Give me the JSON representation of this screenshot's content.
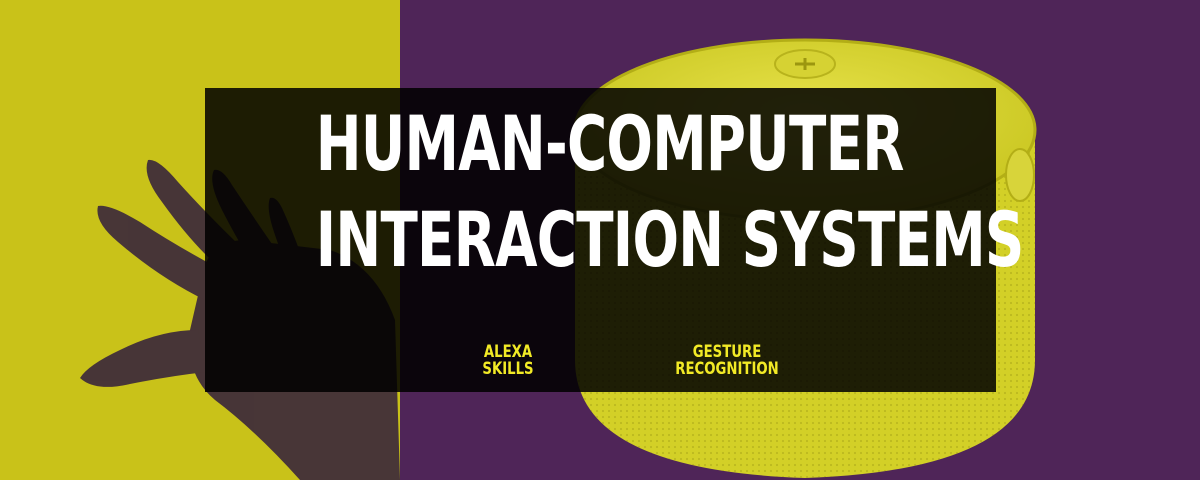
{
  "headline": {
    "line1": "HUMAN-COMPUTER",
    "line2": "INTERACTION SYSTEMS"
  },
  "tags": [
    {
      "line1": "ALEXA",
      "line2": "SKILLS"
    },
    {
      "line1": "GESTURE",
      "line2": "RECOGNITION"
    }
  ],
  "colors": {
    "left_background": "#c9c219",
    "right_background": "#5a2c63",
    "overlay": "#000000",
    "headline_text": "#ffffff",
    "tag_text": "#f2ea26",
    "speaker_body": "#d8d62a",
    "hand_silhouette": "#3d2a3a"
  },
  "icons": {
    "hand": "raised-hand-photo",
    "speaker": "smart-speaker-photo"
  }
}
